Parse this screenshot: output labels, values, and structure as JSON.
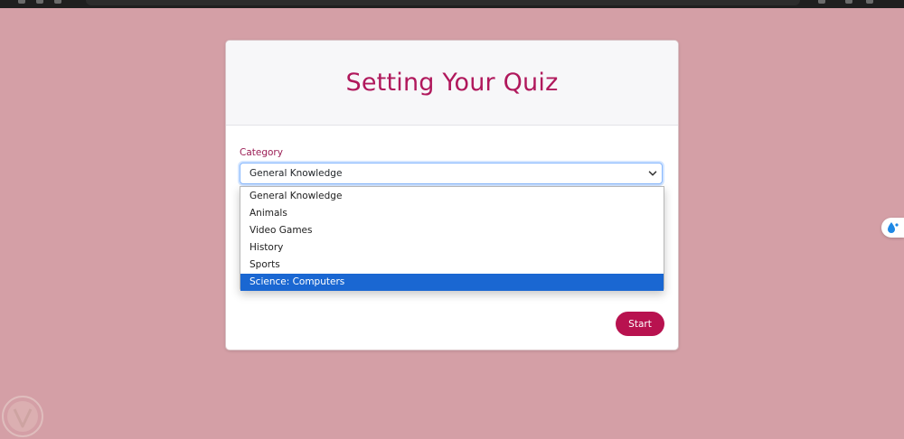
{
  "page": {
    "title": "Setting Your Quiz"
  },
  "form": {
    "category_label": "Category",
    "category_selected": "General Knowledge",
    "category_options": [
      {
        "label": "General Knowledge",
        "highlighted": false
      },
      {
        "label": "Animals",
        "highlighted": false
      },
      {
        "label": "Video Games",
        "highlighted": false
      },
      {
        "label": "History",
        "highlighted": false
      },
      {
        "label": "Sports",
        "highlighted": false
      },
      {
        "label": "Science: Computers",
        "highlighted": true
      }
    ],
    "start_label": "Start"
  },
  "colors": {
    "background": "#d49fa6",
    "title": "#b0185c",
    "label": "#9b1e55",
    "start_button": "#b8124f",
    "highlight": "#1a67d2"
  },
  "icons": {
    "select_arrow": "chevron-down-icon",
    "extension": "water-drop-icon",
    "watermark": "shield-logo-icon"
  }
}
